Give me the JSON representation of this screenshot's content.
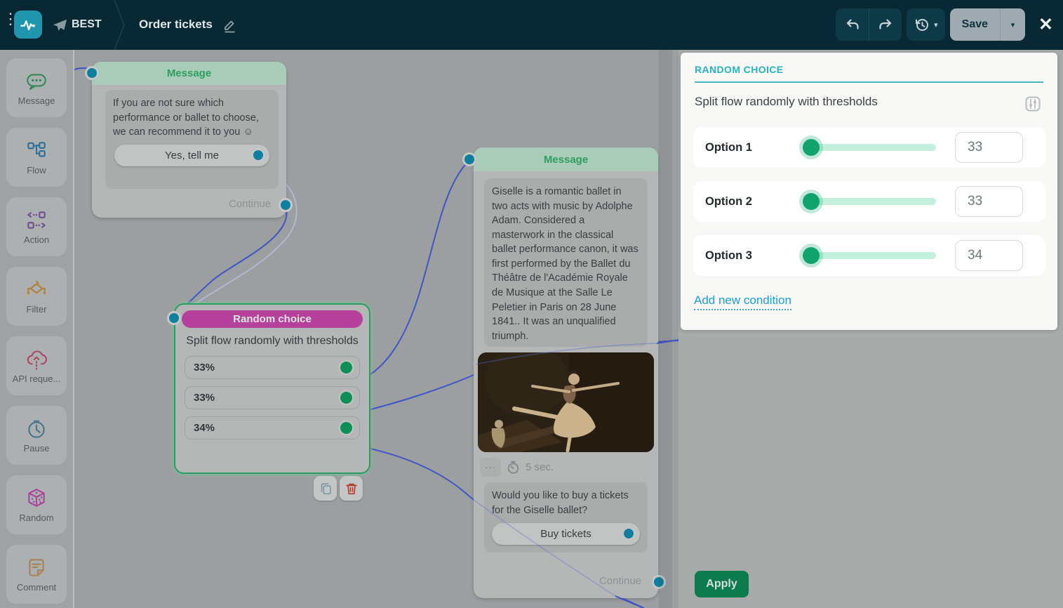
{
  "topbar": {
    "bot_name": "BEST",
    "flow_title": "Order tickets",
    "save_label": "Save"
  },
  "sidebar": {
    "items": [
      {
        "id": "message",
        "label": "Message"
      },
      {
        "id": "flow",
        "label": "Flow"
      },
      {
        "id": "action",
        "label": "Action"
      },
      {
        "id": "filter",
        "label": "Filter"
      },
      {
        "id": "api-request",
        "label": "API reque..."
      },
      {
        "id": "pause",
        "label": "Pause"
      },
      {
        "id": "random",
        "label": "Random"
      },
      {
        "id": "comment",
        "label": "Comment"
      }
    ]
  },
  "canvas": {
    "message1": {
      "header": "Message",
      "text": "If you are not sure which performance or ballet to choose, we can recommend it to you ☺",
      "button": "Yes, tell me",
      "continue_label": "Continue"
    },
    "random_node": {
      "header": "Random choice",
      "subtitle": "Split flow randomly with thresholds",
      "options": [
        "33%",
        "33%",
        "34%"
      ]
    },
    "message2": {
      "header": "Message",
      "text": "Giselle is a romantic ballet in two acts with music by Adolphe Adam. Considered a masterwork in the classical ballet performance canon, it was first performed by the Ballet du Théâtre de l'Académie Royale de Musique at the Salle Le Peletier in Paris on 28 June 1841.. It was an unqualified triumph.",
      "more": "···",
      "delay": "5 sec.",
      "question": "Would you like to buy a tickets for the Giselle ballet?",
      "button": "Buy tickets",
      "continue_label": "Continue"
    }
  },
  "panel": {
    "title": "RANDOM CHOICE",
    "subtitle": "Split flow randomly with thresholds",
    "options": [
      {
        "label": "Option 1",
        "value": "33"
      },
      {
        "label": "Option 2",
        "value": "33"
      },
      {
        "label": "Option 3",
        "value": "34"
      }
    ],
    "add_link": "Add new condition",
    "apply_label": "Apply"
  },
  "colors": {
    "topbar": "#082934",
    "accent_teal": "#27b2be",
    "node_green": "#2e9e60",
    "node_magenta": "#b6419a",
    "slider_green": "#10a36e",
    "link_blue": "#1d9ed2",
    "apply_green": "#0c7b4f",
    "connection_blue": "#3f55c8",
    "dot_teal": "#0e7f9e"
  }
}
